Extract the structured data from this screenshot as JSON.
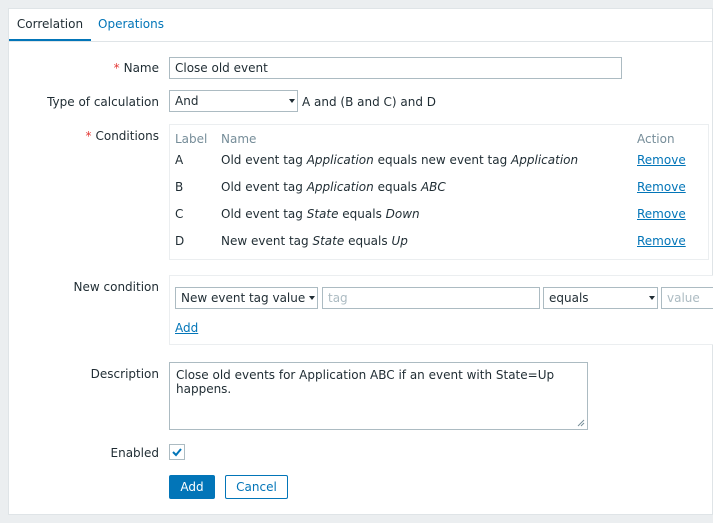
{
  "tabs": [
    {
      "label": "Correlation"
    },
    {
      "label": "Operations"
    }
  ],
  "form": {
    "name_label": "Name",
    "name_value": "Close old event",
    "calc_label": "Type of calculation",
    "calc_value": "And",
    "calc_formula": "A and (B and C) and D",
    "conditions_label": "Conditions",
    "conditions_headers": {
      "label": "Label",
      "name": "Name",
      "action": "Action"
    },
    "conditions": [
      {
        "label": "A",
        "parts": [
          "Old event tag ",
          "Application",
          " equals new event tag ",
          "Application"
        ],
        "action": "Remove"
      },
      {
        "label": "B",
        "parts": [
          "Old event tag ",
          "Application",
          " equals ",
          "ABC"
        ],
        "action": "Remove"
      },
      {
        "label": "C",
        "parts": [
          "Old event tag ",
          "State",
          " equals ",
          "Down"
        ],
        "action": "Remove"
      },
      {
        "label": "D",
        "parts": [
          "New event tag ",
          "State",
          " equals ",
          "Up"
        ],
        "action": "Remove"
      }
    ],
    "new_condition_label": "New condition",
    "new_condition_type": "New event tag value",
    "new_condition_tag_placeholder": "tag",
    "new_condition_operator": "equals",
    "new_condition_value_placeholder": "value",
    "new_condition_add": "Add",
    "description_label": "Description",
    "description_value": "Close old events for Application ABC if an event with State=Up happens.",
    "enabled_label": "Enabled",
    "enabled_checked": true
  },
  "buttons": {
    "add": "Add",
    "cancel": "Cancel"
  },
  "colors": {
    "accent": "#0275b8",
    "required": "#e33734"
  },
  "icons": {
    "checkbox": "checkmark-icon",
    "dropdown": "chevron-down-icon",
    "resize": "resize-grip-icon"
  }
}
